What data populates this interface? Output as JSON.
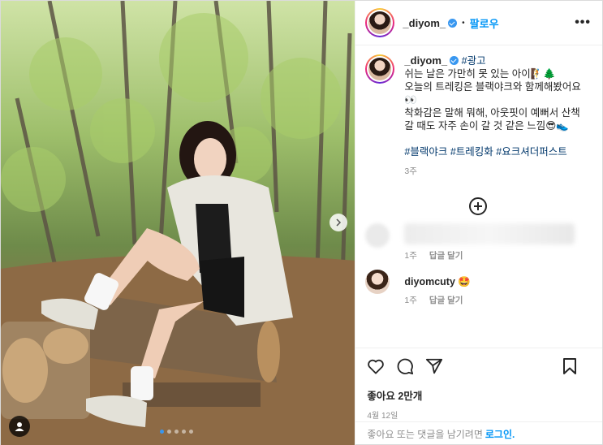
{
  "post": {
    "author": "_diyom_",
    "follow_label": "팔로우",
    "more_label": "•••",
    "separator": "•"
  },
  "caption": {
    "author": "_diyom_",
    "ad_tag": "#광고",
    "text": "쉬는 날은 가만히 못 있는 아이🧗🌲\n오늘의 트레킹은 블랙야크와 함께해봤어요👀\n착화감은 말해 뭐해, 아웃핏이 예뻐서 산책 갈 때도 자주 손이 갈 것 같은 느낌😎👟",
    "hashtags": "#블랙야크 #트레킹화 #요크셔더퍼스트",
    "age": "3주"
  },
  "comments": [
    {
      "author": "",
      "blurred": true,
      "age": "1주",
      "reply_label": "답글 달기"
    },
    {
      "author": "diyomcuty",
      "emoji": "🤩",
      "blurred": false,
      "age": "1주",
      "reply_label": "답글 달기"
    }
  ],
  "actions": {
    "likes": "좋아요 2만개",
    "date": "4월 12일"
  },
  "footer": {
    "prompt": "좋아요 또는 댓글을 남기려면",
    "login_label": "로그인."
  },
  "carousel": {
    "total": 5,
    "active_index": 0
  },
  "colors": {
    "link": "#0095f6",
    "hashtag": "#00376b",
    "verified": "#3897f0"
  },
  "icons": [
    "verified-badge-icon",
    "more-options-icon",
    "load-more-icon",
    "heart-icon",
    "comment-icon",
    "share-icon",
    "bookmark-icon",
    "next-arrow-icon",
    "user-tag-icon"
  ]
}
